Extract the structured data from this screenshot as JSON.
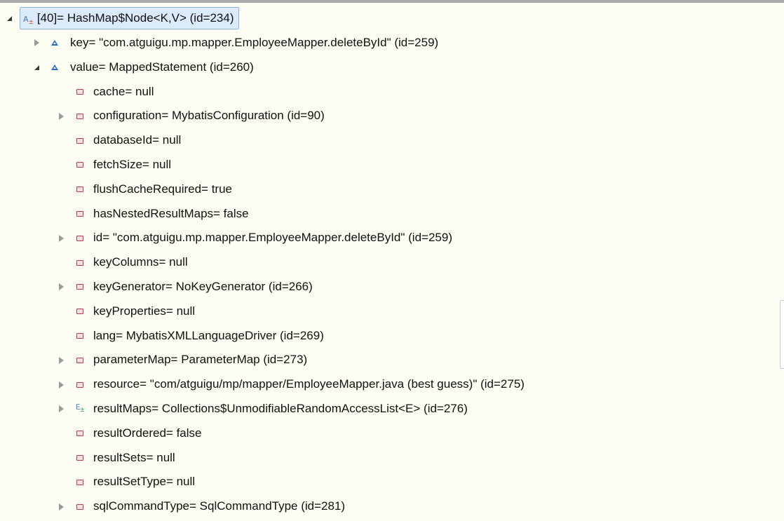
{
  "tree": {
    "root": {
      "label": "[40]= HashMap$Node<K,V>  (id=234)",
      "icon": "map-entry-icon",
      "expanded": true,
      "selected": true
    },
    "children": [
      {
        "label": "key= \"com.atguigu.mp.mapper.EmployeeMapper.deleteById\" (id=259)",
        "icon": "final-field-icon",
        "expandable": true,
        "expanded": false
      },
      {
        "label": "value= MappedStatement  (id=260)",
        "icon": "final-field-icon",
        "expandable": true,
        "expanded": true
      }
    ],
    "value_fields": [
      {
        "label": "cache= null",
        "expandable": false
      },
      {
        "label": "configuration= MybatisConfiguration  (id=90)",
        "expandable": true
      },
      {
        "label": "databaseId= null",
        "expandable": false
      },
      {
        "label": "fetchSize= null",
        "expandable": false
      },
      {
        "label": "flushCacheRequired= true",
        "expandable": false
      },
      {
        "label": "hasNestedResultMaps= false",
        "expandable": false
      },
      {
        "label": "id= \"com.atguigu.mp.mapper.EmployeeMapper.deleteById\" (id=259)",
        "expandable": true
      },
      {
        "label": "keyColumns= null",
        "expandable": false
      },
      {
        "label": "keyGenerator= NoKeyGenerator  (id=266)",
        "expandable": true
      },
      {
        "label": "keyProperties= null",
        "expandable": false
      },
      {
        "label": "lang= MybatisXMLLanguageDriver  (id=269)",
        "expandable": false
      },
      {
        "label": "parameterMap= ParameterMap  (id=273)",
        "expandable": true
      },
      {
        "label": "resource= \"com/atguigu/mp/mapper/EmployeeMapper.java (best guess)\" (id=275)",
        "expandable": true
      },
      {
        "label": "resultMaps= Collections$UnmodifiableRandomAccessList<E>  (id=276)",
        "expandable": true,
        "icon": "list-icon"
      },
      {
        "label": "resultOrdered= false",
        "expandable": false
      },
      {
        "label": "resultSets= null",
        "expandable": false
      },
      {
        "label": "resultSetType= null",
        "expandable": false
      },
      {
        "label": "sqlCommandType= SqlCommandType  (id=281)",
        "expandable": true
      }
    ]
  },
  "colors": {
    "background": "#fdfdf3",
    "selection": "#dcebfb",
    "field_icon": "#c43a4a",
    "final_icon": "#2a6bc2"
  }
}
